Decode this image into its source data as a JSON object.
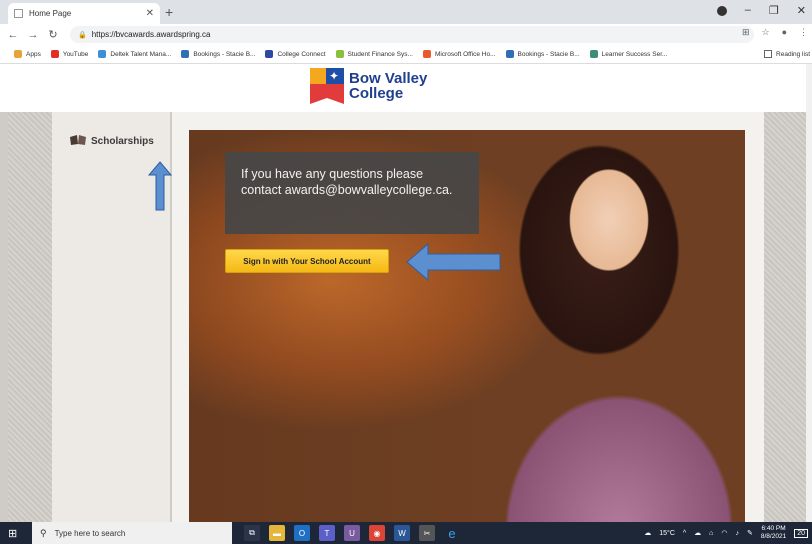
{
  "browser": {
    "tab_title": "Home Page",
    "url": "https://bvcawards.awardspring.ca",
    "bookmarks": [
      {
        "label": "Apps",
        "color": "#e8a33b"
      },
      {
        "label": "YouTube",
        "color": "#e52d27"
      },
      {
        "label": "Deltek Talent Mana...",
        "color": "#3b8fd6"
      },
      {
        "label": "Bookings - Stacie B...",
        "color": "#2f6fb5"
      },
      {
        "label": "College Connect",
        "color": "#2d4aa3"
      },
      {
        "label": "Student Finance Sys...",
        "color": "#8bbf3f"
      },
      {
        "label": "Microsoft Office Ho...",
        "color": "#e85b2d"
      },
      {
        "label": "Bookings - Stacie B...",
        "color": "#2f6fb5"
      },
      {
        "label": "Learner Success Ser...",
        "color": "#3d8c7a"
      }
    ],
    "reading_list": "Reading list"
  },
  "page": {
    "logo_line1": "Bow Valley",
    "logo_line2": "College",
    "sidebar_item": "Scholarships",
    "info_text": "If you have any questions please contact awards@bowvalleycollege.ca.",
    "signin_label": "Sign In with Your School Account"
  },
  "taskbar": {
    "search_placeholder": "Type here to search",
    "weather": "15°C",
    "time": "6:40 PM",
    "date": "8/8/2021",
    "notifications": "20"
  },
  "colors": {
    "annotation_arrow": "#5b8fd0",
    "signin_button": "#f5c12a",
    "logo_blue": "#1f3f8f"
  }
}
